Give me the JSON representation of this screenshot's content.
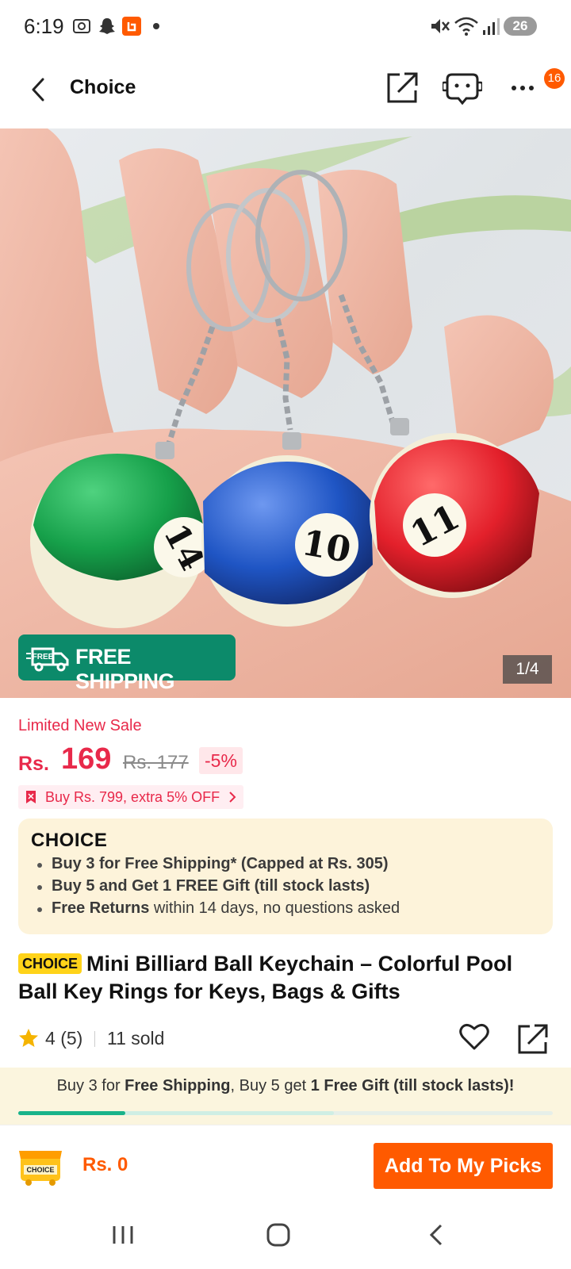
{
  "status_bar": {
    "time": "6:19",
    "battery": "26",
    "icons": [
      "screenshot-icon",
      "snapchat-icon",
      "app-notification-icon",
      "dot-icon",
      "mute-icon",
      "wifi-icon",
      "signal-icon",
      "battery-icon"
    ]
  },
  "header": {
    "title": "Choice",
    "cart_badge": "16",
    "icons": [
      "back-arrow-icon",
      "share-icon",
      "support-robot-icon",
      "more-icon"
    ]
  },
  "gallery": {
    "free_shipping_label": "FREE SHIPPING",
    "free_badge_text": "FREE",
    "counter": "1/4",
    "ball_numbers": [
      "14",
      "10",
      "11"
    ],
    "ball_colors": [
      "#16a04a",
      "#1f55c4",
      "#e3202b"
    ]
  },
  "price": {
    "sale_label": "Limited New Sale",
    "currency": "Rs.",
    "current": "169",
    "original": "Rs. 177",
    "discount": "-5%",
    "coupon_text": "Buy Rs. 799, extra 5% OFF"
  },
  "choice_box": {
    "logo": "CHOICE",
    "items": [
      {
        "bold": "Buy 3 for  Free Shipping* (Capped at Rs. 305)",
        "rest": ""
      },
      {
        "bold": "Buy 5 and Get 1 FREE Gift (till stock lasts)",
        "rest": ""
      },
      {
        "bold": "Free Returns",
        "rest": " within 14 days, no questions asked"
      }
    ]
  },
  "product": {
    "tag": "CHOICE",
    "title": "Mini Billiard Ball Keychain – Colorful Pool Ball Key Rings for Keys, Bags & Gifts",
    "rating": "4",
    "reviews": "(5)",
    "sold": "11 sold"
  },
  "promo": {
    "p1": "Buy 3 for ",
    "p2": "Free Shipping",
    "p3": ", Buy 5 get ",
    "p4": "1 Free Gift (till stock lasts)!",
    "progress_fraction": 0.2
  },
  "bottom_bar": {
    "picks_icon_text": "CHOICE",
    "total": "Rs. 0",
    "add_button": "Add To My Picks"
  },
  "colors": {
    "accent": "#ff5a00",
    "sale_red": "#e8294a",
    "shipping_green": "#0c8a6a",
    "choice_yellow": "#ffd319",
    "choice_bg": "#fdf3da"
  }
}
